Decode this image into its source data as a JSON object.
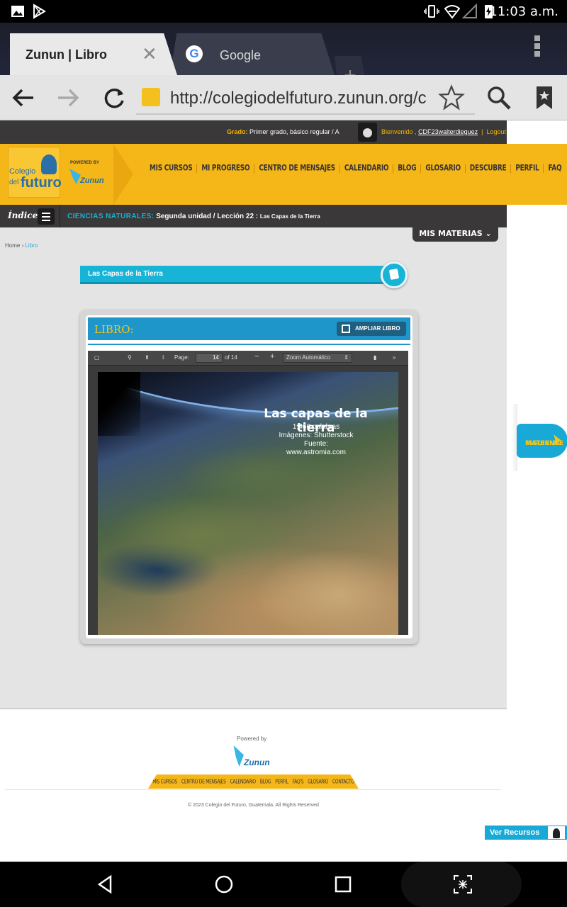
{
  "status_bar": {
    "time": "11:03 a.m.",
    "icons": [
      "image-icon",
      "play-store-icon",
      "vibrate-icon",
      "wifi-icon",
      "signal-icon",
      "battery-charging-icon"
    ]
  },
  "browser": {
    "tabs": [
      {
        "title": "Zunun | Libro",
        "active": true
      },
      {
        "title": "Google",
        "active": false
      }
    ],
    "url": "http://colegiodelfuturo.zunun.org/c",
    "toolbar_icons": [
      "back-icon",
      "forward-icon",
      "reload-icon",
      "star-icon",
      "search-icon",
      "bookmark-icon"
    ]
  },
  "site": {
    "grado_label": "Grado:",
    "grado_value": "Primer grado, básico regular / A",
    "welcome": "Bienvenido ,",
    "username": "CDF23walterdieguez",
    "logout": "Logout",
    "logo": {
      "l1": "Colegio",
      "l2": "del",
      "l3": "futuro"
    },
    "powered_by": "POWERED BY",
    "zunun": "Zunun",
    "menu": [
      "MIS CURSOS",
      "MI PROGRESO",
      "CENTRO DE MENSAJES",
      "CALENDARIO",
      "BLOG",
      "GLOSARIO",
      "DESCUBRE",
      "PERFIL",
      "FAQ"
    ],
    "indice": "Índice",
    "subject": "CIENCIAS NATURALES:",
    "unit_lesson": "Segunda unidad / Lección 22 :",
    "lesson_name": "Las Capas de la Tierra",
    "mis_materias": "MIS MATERIAS",
    "breadcrumb_home": "Home",
    "breadcrumb_sep": "›",
    "breadcrumb_current": "Libro",
    "lesson_title": "Las Capas de la Tierra",
    "book_label": "LIBRO:",
    "ampliar": "AMPLIAR LIBRO",
    "pdf_viewer": {
      "page_label": "Page:",
      "page_current": "14",
      "page_total": "of 14",
      "zoom": "Zoom Automático"
    },
    "pdf_page": {
      "title": "Las capas de la tierra",
      "words": "1,466 palabras",
      "images": "Imágenes: Shutterstock",
      "source_label": "Fuente:",
      "source": "www.astromia.com"
    },
    "siguiente_1": "SIGUIENTE",
    "siguiente_2": "MATERIAL",
    "footer_powered": "Powered by",
    "footer_menu": [
      "MIS CURSOS",
      "CENTRO DE MENSAJES",
      "CALENDARIO",
      "BLOG",
      "PERFIL",
      "FAQ'S",
      "GLOSARIO",
      "CONTACTO"
    ],
    "copyright": "© 2023 Colegio del Futuro, Guatemala. All Rights Reserved",
    "ver_recursos": "Ver Recursos"
  },
  "colors": {
    "brand_yellow": "#f5b718",
    "brand_blue": "#18b4d8",
    "dark_bar": "#3a3838"
  }
}
